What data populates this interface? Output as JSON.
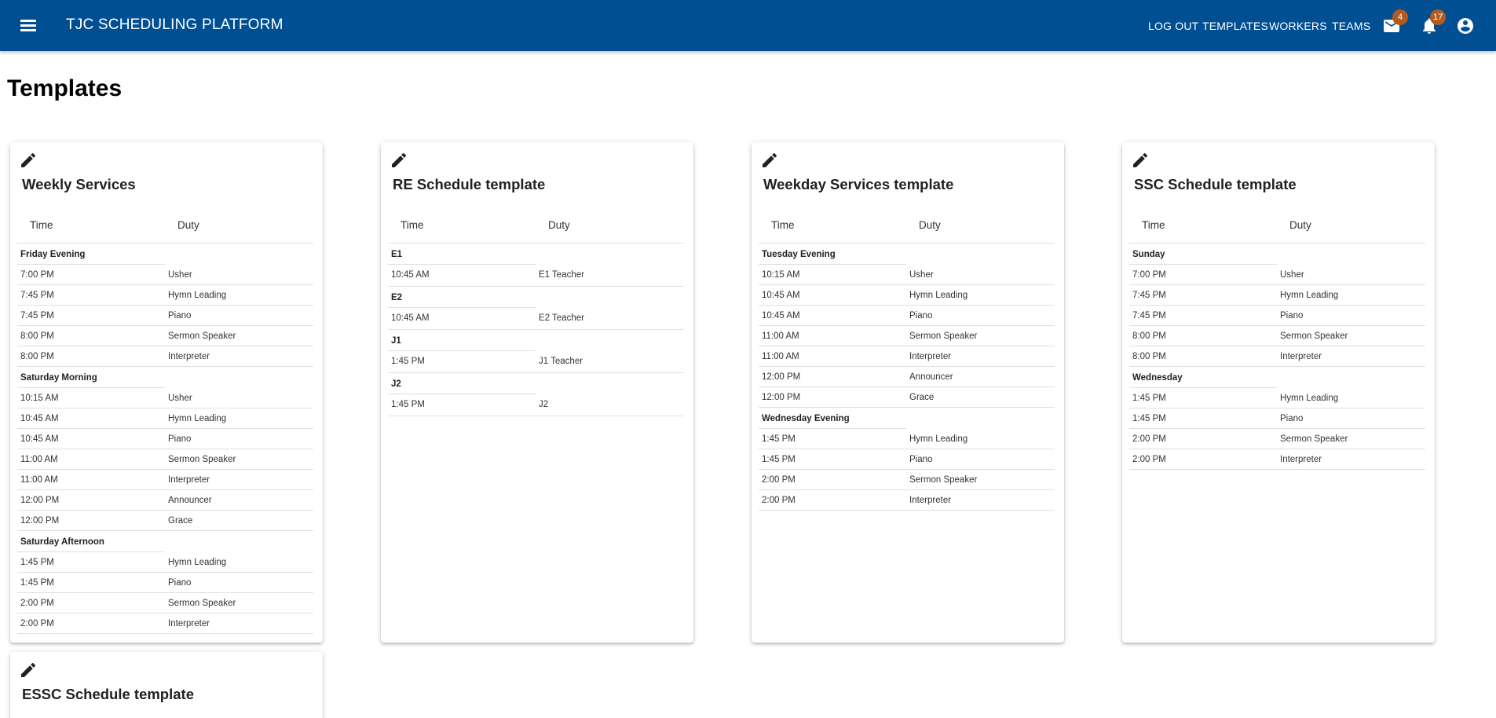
{
  "header": {
    "app_title": "TJC SCHEDULING PLATFORM",
    "nav": {
      "logout": "LOG OUT",
      "templates": "TEMPLATES",
      "workers": "WORKERS",
      "teams": "TEAMS"
    },
    "mail_badge": "4",
    "notifications_badge": "17"
  },
  "page": {
    "title": "Templates"
  },
  "columns": {
    "time": "Time",
    "duty": "Duty"
  },
  "cards": [
    {
      "title": "Weekly Services",
      "groups": [
        {
          "name": "Friday Evening",
          "rows": [
            {
              "time": "7:00 PM",
              "duty": "Usher"
            },
            {
              "time": "7:45 PM",
              "duty": "Hymn Leading"
            },
            {
              "time": "7:45 PM",
              "duty": "Piano"
            },
            {
              "time": "8:00 PM",
              "duty": "Sermon Speaker"
            },
            {
              "time": "8:00 PM",
              "duty": "Interpreter"
            }
          ]
        },
        {
          "name": "Saturday Morning",
          "rows": [
            {
              "time": "10:15 AM",
              "duty": "Usher"
            },
            {
              "time": "10:45 AM",
              "duty": "Hymn Leading"
            },
            {
              "time": "10:45 AM",
              "duty": "Piano"
            },
            {
              "time": "11:00 AM",
              "duty": "Sermon Speaker"
            },
            {
              "time": "11:00 AM",
              "duty": "Interpreter"
            },
            {
              "time": "12:00 PM",
              "duty": "Announcer"
            },
            {
              "time": "12:00 PM",
              "duty": "Grace"
            }
          ]
        },
        {
          "name": "Saturday Afternoon",
          "rows": [
            {
              "time": "1:45 PM",
              "duty": "Hymn Leading"
            },
            {
              "time": "1:45 PM",
              "duty": "Piano"
            },
            {
              "time": "2:00 PM",
              "duty": "Sermon Speaker"
            },
            {
              "time": "2:00 PM",
              "duty": "Interpreter"
            }
          ]
        }
      ]
    },
    {
      "title": "RE Schedule template",
      "groups": [
        {
          "name": "E1",
          "rows": [
            {
              "time": "10:45 AM",
              "duty": "E1 Teacher"
            }
          ]
        },
        {
          "name": "E2",
          "rows": [
            {
              "time": "10:45 AM",
              "duty": "E2 Teacher"
            }
          ]
        },
        {
          "name": "J1",
          "rows": [
            {
              "time": "1:45 PM",
              "duty": "J1 Teacher"
            }
          ]
        },
        {
          "name": "J2",
          "rows": [
            {
              "time": "1:45 PM",
              "duty": "J2"
            }
          ]
        }
      ]
    },
    {
      "title": "Weekday Services template",
      "groups": [
        {
          "name": "Tuesday Evening",
          "rows": [
            {
              "time": "10:15 AM",
              "duty": "Usher"
            },
            {
              "time": "10:45 AM",
              "duty": "Hymn Leading"
            },
            {
              "time": "10:45 AM",
              "duty": "Piano"
            },
            {
              "time": "11:00 AM",
              "duty": "Sermon Speaker"
            },
            {
              "time": "11:00 AM",
              "duty": "Interpreter"
            },
            {
              "time": "12:00 PM",
              "duty": "Announcer"
            },
            {
              "time": "12:00 PM",
              "duty": "Grace"
            }
          ]
        },
        {
          "name": "Wednesday Evening",
          "rows": [
            {
              "time": "1:45 PM",
              "duty": "Hymn Leading"
            },
            {
              "time": "1:45 PM",
              "duty": "Piano"
            },
            {
              "time": "2:00 PM",
              "duty": "Sermon Speaker"
            },
            {
              "time": "2:00 PM",
              "duty": "Interpreter"
            }
          ]
        }
      ]
    },
    {
      "title": "SSC Schedule template",
      "groups": [
        {
          "name": "Sunday",
          "rows": [
            {
              "time": "7:00 PM",
              "duty": "Usher"
            },
            {
              "time": "7:45 PM",
              "duty": "Hymn Leading"
            },
            {
              "time": "7:45 PM",
              "duty": "Piano"
            },
            {
              "time": "8:00 PM",
              "duty": "Sermon Speaker"
            },
            {
              "time": "8:00 PM",
              "duty": "Interpreter"
            }
          ]
        },
        {
          "name": "Wednesday",
          "rows": [
            {
              "time": "1:45 PM",
              "duty": "Hymn Leading"
            },
            {
              "time": "1:45 PM",
              "duty": "Piano"
            },
            {
              "time": "2:00 PM",
              "duty": "Sermon Speaker"
            },
            {
              "time": "2:00 PM",
              "duty": "Interpreter"
            }
          ]
        }
      ]
    },
    {
      "title": "ESSC Schedule template",
      "groups": []
    }
  ]
}
